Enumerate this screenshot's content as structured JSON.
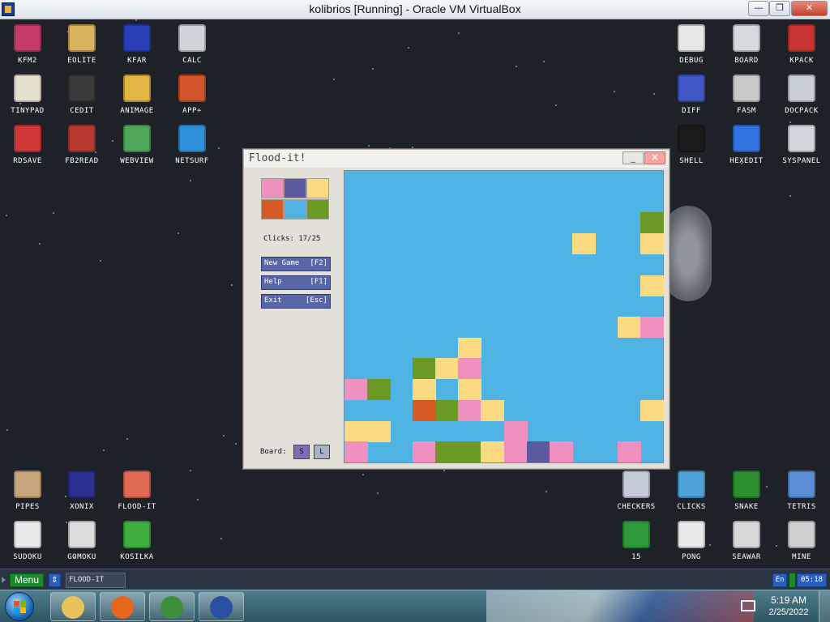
{
  "host_window": {
    "title": "kolibrios [Running] - Oracle VM VirtualBox",
    "minimize_label": "—",
    "maximize_label": "❐",
    "close_label": "✕"
  },
  "desktop": {
    "icons_left": [
      {
        "label": "KFM2",
        "icon": "floppy-icon",
        "color": "#c43b6a"
      },
      {
        "label": "EOLITE",
        "icon": "folder-icon",
        "color": "#d9b35c"
      },
      {
        "label": "KFAR",
        "icon": "commander-icon",
        "color": "#2a3fb8"
      },
      {
        "label": "CALC",
        "icon": "calculator-icon",
        "color": "#cfd3da"
      },
      {
        "label": "TINYPAD",
        "icon": "notepad-icon",
        "color": "#e6e0cf"
      },
      {
        "label": "CEDIT",
        "icon": "code-editor-icon",
        "color": "#3a3a3a"
      },
      {
        "label": "ANIMAGE",
        "icon": "paint-tools-icon",
        "color": "#e2b544"
      },
      {
        "label": "APP+",
        "icon": "cube-icon",
        "color": "#d4552d"
      },
      {
        "label": "RDSAVE",
        "icon": "save-screen-icon",
        "color": "#d03838"
      },
      {
        "label": "FB2READ",
        "icon": "book-icon",
        "color": "#b5392f"
      },
      {
        "label": "WEBVIEW",
        "icon": "web-browser-icon",
        "color": "#4fa85a"
      },
      {
        "label": "NETSURF",
        "icon": "globe-icon",
        "color": "#2f8fd6"
      },
      {
        "label": "PIPES",
        "icon": "pipes-icon",
        "color": "#c7a57a"
      },
      {
        "label": "XONIX",
        "icon": "xonix-icon",
        "color": "#2b2f8f"
      },
      {
        "label": "FLOOD-IT",
        "icon": "flood-it-icon",
        "color": "#e16a53"
      },
      {
        "label": "SUDOKU",
        "icon": "sudoku-icon",
        "color": "#e9e9e9"
      },
      {
        "label": "GOMOKU",
        "icon": "gomoku-icon",
        "color": "#dcdcdc"
      },
      {
        "label": "KOSILKA",
        "icon": "lawnmower-icon",
        "color": "#3fae3f"
      }
    ],
    "icons_right": [
      {
        "label": "DEBUG",
        "icon": "bug-icon",
        "color": "#e7e7e7"
      },
      {
        "label": "BOARD",
        "icon": "board-icon",
        "color": "#d6d9de"
      },
      {
        "label": "KPACK",
        "icon": "tools-icon",
        "color": "#c83434"
      },
      {
        "label": "DIFF",
        "icon": "diff-icon",
        "color": "#4156c6"
      },
      {
        "label": "FASM",
        "icon": "assembler-icon",
        "color": "#c9c9c9"
      },
      {
        "label": "DOCPACK",
        "icon": "cabinet-icon",
        "color": "#c9cfd6"
      },
      {
        "label": "SHELL",
        "icon": "terminal-icon",
        "color": "#1b1b1b"
      },
      {
        "label": "HEXEDIT",
        "icon": "hex-editor-icon",
        "color": "#2f72e0"
      },
      {
        "label": "SYSPANEL",
        "icon": "control-panel-icon",
        "color": "#d2d6dc"
      },
      {
        "label": "CHECKERS",
        "icon": "checkers-icon",
        "color": "#c4cbd6"
      },
      {
        "label": "CLICKS",
        "icon": "clicks-icon",
        "color": "#4fa3d8"
      },
      {
        "label": "SNAKE",
        "icon": "snake-icon",
        "color": "#2d8f2d"
      },
      {
        "label": "TETRIS",
        "icon": "tetris-icon",
        "color": "#5a8fd8"
      },
      {
        "label": "15",
        "icon": "fifteen-puzzle-icon",
        "color": "#2d9b3a"
      },
      {
        "label": "PONG",
        "icon": "pong-icon",
        "color": "#e9e9e9"
      },
      {
        "label": "SEAWAR",
        "icon": "seawar-icon",
        "color": "#d8d8d8"
      },
      {
        "label": "MINE",
        "icon": "mine-icon",
        "color": "#cfcfcf"
      }
    ]
  },
  "flood_window": {
    "title": "Flood-it!",
    "minimize_label": "_",
    "close_label": "✕",
    "palette": [
      "#f090c0",
      "#5c5a9e",
      "#fadb82",
      "#d65a24",
      "#4fb4e4",
      "#6b9a24"
    ],
    "clicks_text": "Clicks: 17/25",
    "buttons": [
      {
        "label": "New Game",
        "key": "[F2]"
      },
      {
        "label": "Help",
        "key": "[F1]"
      },
      {
        "label": "Exit",
        "key": "[Esc]"
      }
    ],
    "board_label": "Board:",
    "size_small": "S",
    "size_large": "L"
  },
  "board": {
    "rows": 14,
    "cols": 14,
    "default_color": "#4fb4e4",
    "colors": {
      "p": "#f090c0",
      "y": "#fadb82",
      "g": "#6b9a24",
      "r": "#d65a24",
      "v": "#5c5a9e"
    },
    "cells": [
      [
        2,
        13,
        "g"
      ],
      [
        3,
        10,
        "y"
      ],
      [
        3,
        13,
        "y"
      ],
      [
        5,
        13,
        "y"
      ],
      [
        7,
        12,
        "y"
      ],
      [
        7,
        13,
        "p"
      ],
      [
        8,
        5,
        "y"
      ],
      [
        9,
        3,
        "g"
      ],
      [
        9,
        4,
        "y"
      ],
      [
        9,
        5,
        "p"
      ],
      [
        10,
        0,
        "p"
      ],
      [
        10,
        1,
        "g"
      ],
      [
        10,
        3,
        "y"
      ],
      [
        10,
        5,
        "y"
      ],
      [
        11,
        3,
        "r"
      ],
      [
        11,
        4,
        "g"
      ],
      [
        11,
        5,
        "p"
      ],
      [
        11,
        6,
        "y"
      ],
      [
        11,
        13,
        "y"
      ],
      [
        12,
        0,
        "y"
      ],
      [
        12,
        1,
        "y"
      ],
      [
        12,
        7,
        "p"
      ],
      [
        13,
        0,
        "p"
      ],
      [
        13,
        3,
        "p"
      ],
      [
        13,
        4,
        "g"
      ],
      [
        13,
        5,
        "g"
      ],
      [
        13,
        6,
        "y"
      ],
      [
        13,
        7,
        "p"
      ],
      [
        13,
        8,
        "v"
      ],
      [
        13,
        9,
        "p"
      ],
      [
        13,
        12,
        "p"
      ]
    ]
  },
  "kolibri_taskbar": {
    "menu_label": "Menu",
    "switch_label": "⇕",
    "task_label": "FLOOD-IT",
    "lang_label": "En",
    "clock": "05:18"
  },
  "windows_taskbar": {
    "apps": [
      {
        "name": "explorer",
        "icon": "folder-icon",
        "color": "#e8c25a"
      },
      {
        "name": "firefox",
        "icon": "firefox-icon",
        "color": "#e8651c"
      },
      {
        "name": "chrome",
        "icon": "chrome-icon",
        "color": "#3d8f3d"
      },
      {
        "name": "virtualbox",
        "icon": "virtualbox-icon",
        "color": "#2b4fa3"
      }
    ],
    "time": "5:19 AM",
    "date": "2/25/2022"
  }
}
